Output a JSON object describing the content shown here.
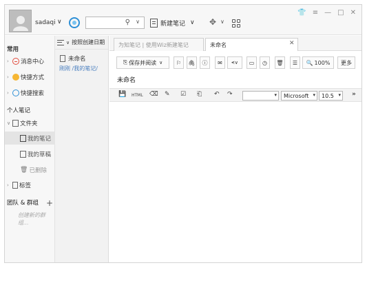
{
  "header": {
    "username": "sadaqi",
    "user_caret": "∨",
    "search_placeholder": "",
    "search_icon": "⚲",
    "search_caret": "∨",
    "new_note_label": "新建笔记",
    "new_note_caret": "∨",
    "move_caret": "∨",
    "window_controls": [
      "⚲",
      "⚲",
      "—",
      "□",
      "✕"
    ]
  },
  "sidebar": {
    "section_common": "常用",
    "items_common": [
      "消息中心",
      "快捷方式",
      "快捷搜索"
    ],
    "section_personal": "个人笔记",
    "folder": "文件夹",
    "subfolders": [
      "我的笔记",
      "我的草稿",
      "已删除"
    ],
    "tags": "标签",
    "section_team": "团队 & 群组",
    "add_icon": "+",
    "create_group": "创建新的群组..."
  },
  "note_list": {
    "sort_label": "按照创建日期",
    "sort_caret": "∨",
    "items": [
      {
        "title": "未命名",
        "meta": "刚刚  /我的笔记/"
      }
    ]
  },
  "editor": {
    "tabs": [
      "为知笔记 | 使用Wiz新建笔记",
      "未命名"
    ],
    "tab_close": "✕",
    "save_read": "保存并阅读",
    "zoom": "100%",
    "more": "更多",
    "note_title": "未命名",
    "font_name": "Microsoft",
    "font_size": "10.5",
    "expand": "»"
  }
}
